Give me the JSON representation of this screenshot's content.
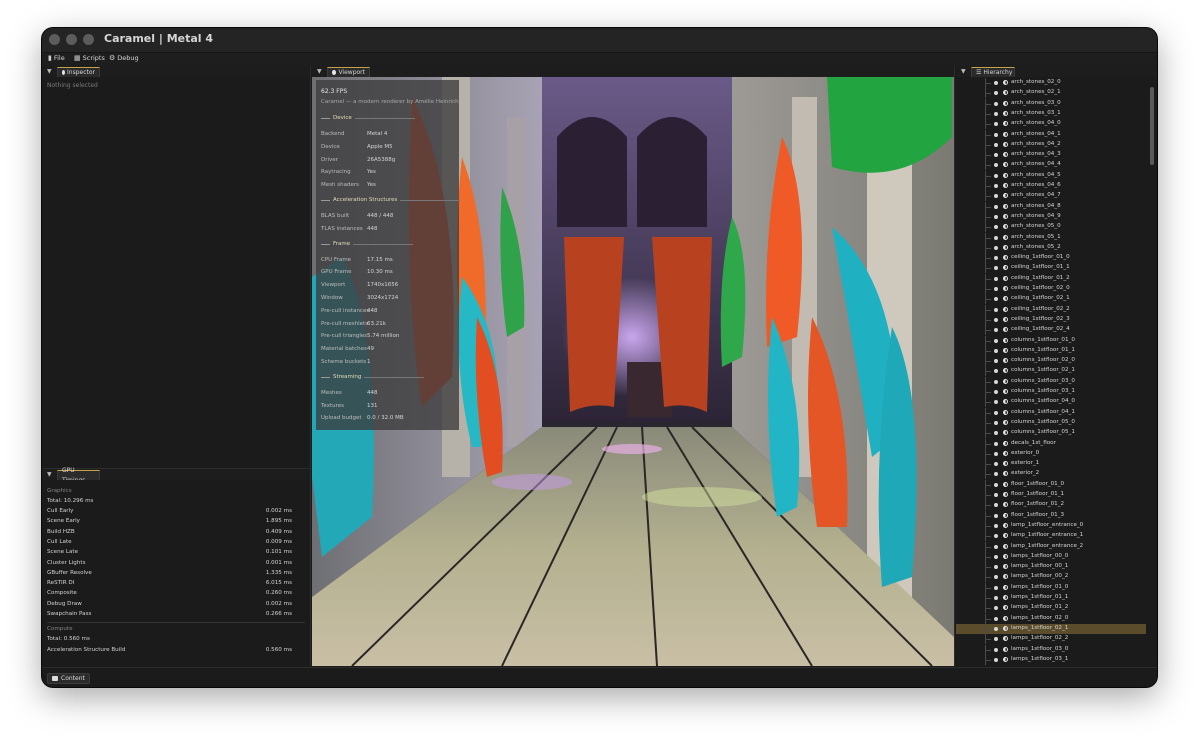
{
  "window": {
    "title": "Caramel | Metal 4"
  },
  "menu": [
    {
      "label": "File",
      "icon": "file-icon"
    },
    {
      "label": "Scripts",
      "icon": "scripts-icon"
    },
    {
      "label": "Debug",
      "icon": "gear-icon"
    }
  ],
  "inspector": {
    "tab_label": "Inspector",
    "empty_text": "Nothing selected"
  },
  "gpu_timings": {
    "tab_label": "GPU Timings",
    "graphics_header": "Graphics",
    "graphics_total": "Total: 10.296 ms",
    "graphics_rows": [
      {
        "name": "Cull Early",
        "value": "0.002 ms"
      },
      {
        "name": "Scene Early",
        "value": "1.895 ms"
      },
      {
        "name": "Build HZB",
        "value": "0.409 ms"
      },
      {
        "name": "Cull Late",
        "value": "0.009 ms"
      },
      {
        "name": "Scene Late",
        "value": "0.101 ms"
      },
      {
        "name": "Cluster Lights",
        "value": "0.001 ms"
      },
      {
        "name": "GBuffer Resolve",
        "value": "1.335 ms"
      },
      {
        "name": "ReSTIR DI",
        "value": "6.015 ms"
      },
      {
        "name": "Composite",
        "value": "0.260 ms"
      },
      {
        "name": "Debug Draw",
        "value": "0.002 ms"
      },
      {
        "name": "Swapchain Pass",
        "value": "0.266 ms"
      }
    ],
    "compute_header": "Compute",
    "compute_total": "Total: 0.560 ms",
    "compute_rows": [
      {
        "name": "Acceleration Structure Build",
        "value": "0.560 ms"
      }
    ]
  },
  "viewport": {
    "tab_label": "Viewport",
    "overlay": {
      "fps": "62.3 FPS",
      "subtitle": "Caramel — a modern renderer by Amélie Heinrich",
      "sections": [
        {
          "title": "Device",
          "rows": [
            {
              "k": "Backend",
              "v": "Metal 4"
            },
            {
              "k": "Device",
              "v": "Apple M5"
            },
            {
              "k": "Driver",
              "v": "26A5388g"
            },
            {
              "k": "Raytracing",
              "v": "Yes"
            },
            {
              "k": "Mesh shaders",
              "v": "Yes"
            }
          ]
        },
        {
          "title": "Acceleration Structures",
          "rows": [
            {
              "k": "BLAS built",
              "v": "448 / 448"
            },
            {
              "k": "TLAS instances",
              "v": "448"
            }
          ]
        },
        {
          "title": "Frame",
          "rows": [
            {
              "k": "CPU Frame",
              "v": "17.15 ms"
            },
            {
              "k": "GPU Frame",
              "v": "10.30 ms"
            },
            {
              "k": "Viewport",
              "v": "1740x1656"
            },
            {
              "k": "Window",
              "v": "3024x1724"
            },
            {
              "k": "Pre-cull instances",
              "v": "448"
            },
            {
              "k": "Pre-cull meshlets",
              "v": "63.21k"
            },
            {
              "k": "Pre-cull triangles",
              "v": "5.74 million"
            },
            {
              "k": "Material batches",
              "v": "49"
            },
            {
              "k": "Scheme buckets",
              "v": "1"
            }
          ]
        },
        {
          "title": "Streaming",
          "rows": [
            {
              "k": "Meshes",
              "v": "448"
            },
            {
              "k": "Textures",
              "v": "131"
            },
            {
              "k": "Upload budget",
              "v": "0.0 / 32.0 MB"
            }
          ]
        }
      ]
    }
  },
  "hierarchy": {
    "tab_label": "Hierarchy",
    "items": [
      "arch_stones_02_0",
      "arch_stones_02_1",
      "arch_stones_03_0",
      "arch_stones_03_1",
      "arch_stones_04_0",
      "arch_stones_04_1",
      "arch_stones_04_2",
      "arch_stones_04_3",
      "arch_stones_04_4",
      "arch_stones_04_5",
      "arch_stones_04_6",
      "arch_stones_04_7",
      "arch_stones_04_8",
      "arch_stones_04_9",
      "arch_stones_05_0",
      "arch_stones_05_1",
      "arch_stones_05_2",
      "ceiling_1stfloor_01_0",
      "ceiling_1stfloor_01_1",
      "ceiling_1stfloor_01_2",
      "ceiling_1stfloor_02_0",
      "ceiling_1stfloor_02_1",
      "ceiling_1stfloor_02_2",
      "ceiling_1stfloor_02_3",
      "ceiling_1stfloor_02_4",
      "columns_1stfloor_01_0",
      "columns_1stfloor_01_1",
      "columns_1stfloor_02_0",
      "columns_1stfloor_02_1",
      "columns_1stfloor_03_0",
      "columns_1stfloor_03_1",
      "columns_1stfloor_04_0",
      "columns_1stfloor_04_1",
      "columns_1stfloor_05_0",
      "columns_1stfloor_05_1",
      "decals_1st_floor",
      "exterior_0",
      "exterior_1",
      "exterior_2",
      "floor_1stfloor_01_0",
      "floor_1stfloor_01_1",
      "floor_1stfloor_01_2",
      "floor_1stfloor_01_3",
      "lamp_1stfloor_entrance_0",
      "lamp_1stfloor_entrance_1",
      "lamp_1stfloor_entrance_2",
      "lamps_1stfloor_00_0",
      "lamps_1stfloor_00_1",
      "lamps_1stfloor_00_2",
      "lamps_1stfloor_01_0",
      "lamps_1stfloor_01_1",
      "lamps_1stfloor_01_2",
      "lamps_1stfloor_02_0",
      "lamps_1stfloor_02_1",
      "lamps_1stfloor_02_2",
      "lamps_1stfloor_03_0",
      "lamps_1stfloor_03_1"
    ],
    "selected": "lamps_1stfloor_02_1"
  },
  "bottom": {
    "content_label": "Content"
  },
  "colors": {
    "accent": "#c7a24a",
    "selection": "#5b4d2c",
    "panel": "#1b1b1b"
  }
}
